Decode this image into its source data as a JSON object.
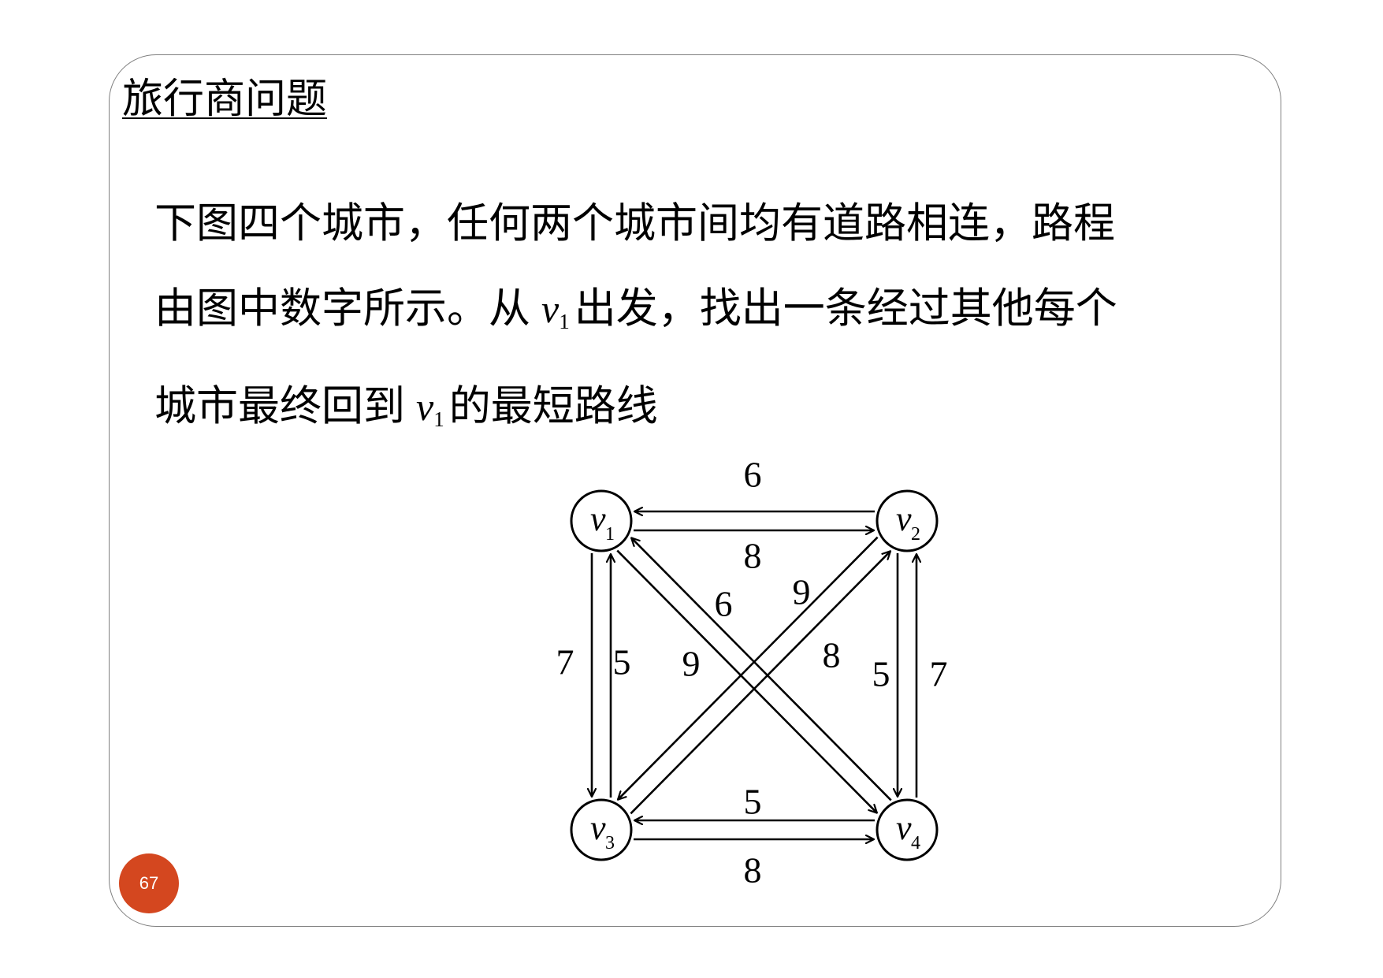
{
  "slide": {
    "title": "旅行商问题",
    "page_number": "67",
    "accent_color": "#d4471f",
    "paragraph": {
      "line1": "下图四个城市，任何两个城市间均有道路相连，路程",
      "line2_before": "由图中数字所示。从",
      "line2_var": "v",
      "line2_sub": "1",
      "line2_after": "出发，找出一条经过其他每个",
      "line3_before": "城市最终回到",
      "line3_var": "v",
      "line3_sub": "1",
      "line3_after": "的最短路线"
    }
  },
  "graph": {
    "nodes": [
      {
        "id": "v1",
        "var": "v",
        "sub": "1"
      },
      {
        "id": "v2",
        "var": "v",
        "sub": "2"
      },
      {
        "id": "v3",
        "var": "v",
        "sub": "3"
      },
      {
        "id": "v4",
        "var": "v",
        "sub": "4"
      }
    ],
    "edges": [
      {
        "from": "v2",
        "to": "v1",
        "weight": "6"
      },
      {
        "from": "v1",
        "to": "v2",
        "weight": "8"
      },
      {
        "from": "v3",
        "to": "v1",
        "weight": "7"
      },
      {
        "from": "v1",
        "to": "v3",
        "weight": "5"
      },
      {
        "from": "v4",
        "to": "v1",
        "weight": "6"
      },
      {
        "from": "v1",
        "to": "v4",
        "weight": "9"
      },
      {
        "from": "v3",
        "to": "v2",
        "weight": "9"
      },
      {
        "from": "v2",
        "to": "v3",
        "weight": "8"
      },
      {
        "from": "v2",
        "to": "v4",
        "weight": "5"
      },
      {
        "from": "v4",
        "to": "v2",
        "weight": "7"
      },
      {
        "from": "v3",
        "to": "v4",
        "weight": "5"
      },
      {
        "from": "v4",
        "to": "v3",
        "weight": "8"
      }
    ]
  }
}
